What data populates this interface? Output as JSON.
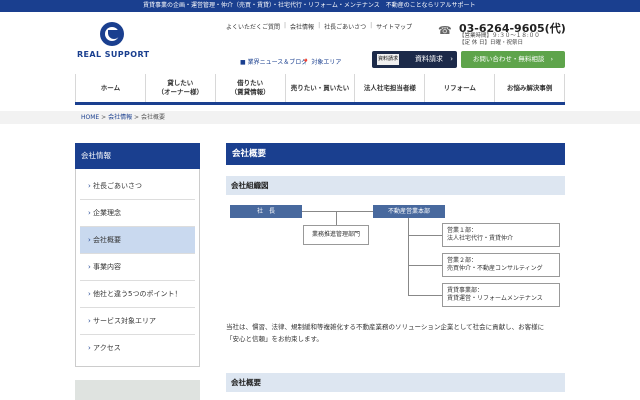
{
  "topbar": {
    "text": "賃貸事業の企画・運営管理・仲介（売買・賃貸）・社宅代行・リフォーム・メンテナンス　不動産のことならリアルサポート"
  },
  "logo": {
    "text": "REAL SUPPORT"
  },
  "util_nav": [
    "よくいただくご質問",
    "会社情報",
    "社長ごあいさつ",
    "サイトマップ"
  ],
  "contact": {
    "phone": "03-6264-9605(代)",
    "hours_line1": "【営業時間】９:３０〜１８:００",
    "hours_line2": "【定 休 日】日曜・祝祭日"
  },
  "links": {
    "news": "業界ニュース＆ブログ",
    "area": "対象エリア"
  },
  "buttons": {
    "request_tag": "資料請求",
    "request": "資料請求",
    "contact": "お問い合わせ・無料相談"
  },
  "main_nav": [
    {
      "label": "ホーム"
    },
    {
      "label": "貸したい\n（オーナー様）"
    },
    {
      "label": "借りたい\n（賃貸情報）"
    },
    {
      "label": "売りたい・買いたい"
    },
    {
      "label": "法人社宅担当者様"
    },
    {
      "label": "リフォーム"
    },
    {
      "label": "お悩み解決事例"
    }
  ],
  "breadcrumb": {
    "home": "HOME",
    "company": "会社情報",
    "current": "会社概要",
    "sep": ">"
  },
  "sidebar": {
    "title": "会社情報",
    "items": [
      {
        "label": "社長ごあいさつ"
      },
      {
        "label": "企業理念"
      },
      {
        "label": "会社概要"
      },
      {
        "label": "事業内容"
      },
      {
        "label": "他社と違う5つのポイント！"
      },
      {
        "label": "サービス対象エリア"
      },
      {
        "label": "アクセス"
      }
    ]
  },
  "main": {
    "title": "会社概要",
    "section1": "会社組織図",
    "org": {
      "president": "社　長",
      "planning": "業務推進管理部門",
      "realestate": "不動産営業本部",
      "dept1_a": "営業１部：",
      "dept1_b": "法人社宅代行・賃貸仲介",
      "dept2_a": "営業２部：",
      "dept2_b": "売買仲介・不動産コンサルティング",
      "dept3_a": "賃貸事業部：",
      "dept3_b": "賃貸運営・リフォームメンテナンス"
    },
    "description": "当社は、慣習、法律、規制緩和等複雑化する不動産業務のソリューション企業として社会に貢献し、お客様に「安心と信頼」をお約束します。",
    "section2": "会社概要"
  },
  "colors": {
    "brand": "#1a3f8f",
    "green": "#5ea44b",
    "dark": "#1c2a49",
    "light_blue": "#dde6f1"
  }
}
